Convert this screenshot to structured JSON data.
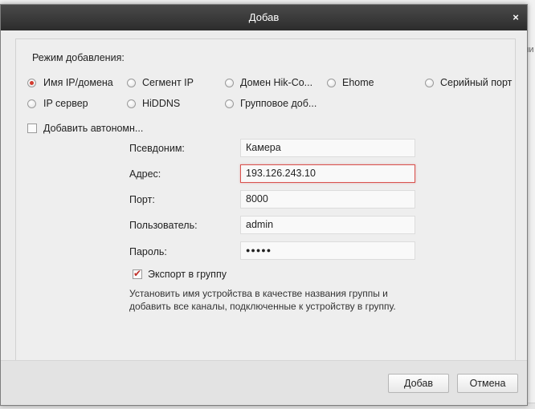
{
  "dialog": {
    "title": "Добав",
    "close_icon": "×"
  },
  "add_mode": {
    "label": "Режим добавления:",
    "options": [
      {
        "label": "Имя IP/домена",
        "checked": true
      },
      {
        "label": "Сегмент IP",
        "checked": false
      },
      {
        "label": "Домен Hik-Co...",
        "checked": false
      },
      {
        "label": "Ehome",
        "checked": false
      },
      {
        "label": "Серийный порт",
        "checked": false
      },
      {
        "label": "IP сервер",
        "checked": false
      },
      {
        "label": "HiDDNS",
        "checked": false
      },
      {
        "label": "Групповое доб...",
        "checked": false
      }
    ]
  },
  "offline_add": {
    "label": "Добавить автономн...",
    "checked": false
  },
  "form": {
    "nickname": {
      "label": "Псевдоним:",
      "value": "Камера"
    },
    "address": {
      "label": "Адрес:",
      "value": "193.126.243.10"
    },
    "port": {
      "label": "Порт:",
      "value": "8000"
    },
    "user": {
      "label": "Пользователь:",
      "value": "admin"
    },
    "password": {
      "label": "Пароль:",
      "value": "●●●●●"
    }
  },
  "export_group": {
    "label": "Экспорт в группу",
    "checked": true,
    "hint": "Установить имя устройства в качестве названия группы и добавить все каналы, подключенные к устройству в группу."
  },
  "buttons": {
    "add": "Добав",
    "cancel": "Отмена"
  },
  "background": {
    "right_text": "ли"
  },
  "colors": {
    "accent": "#d23a2e",
    "titlebar": "#333333"
  }
}
